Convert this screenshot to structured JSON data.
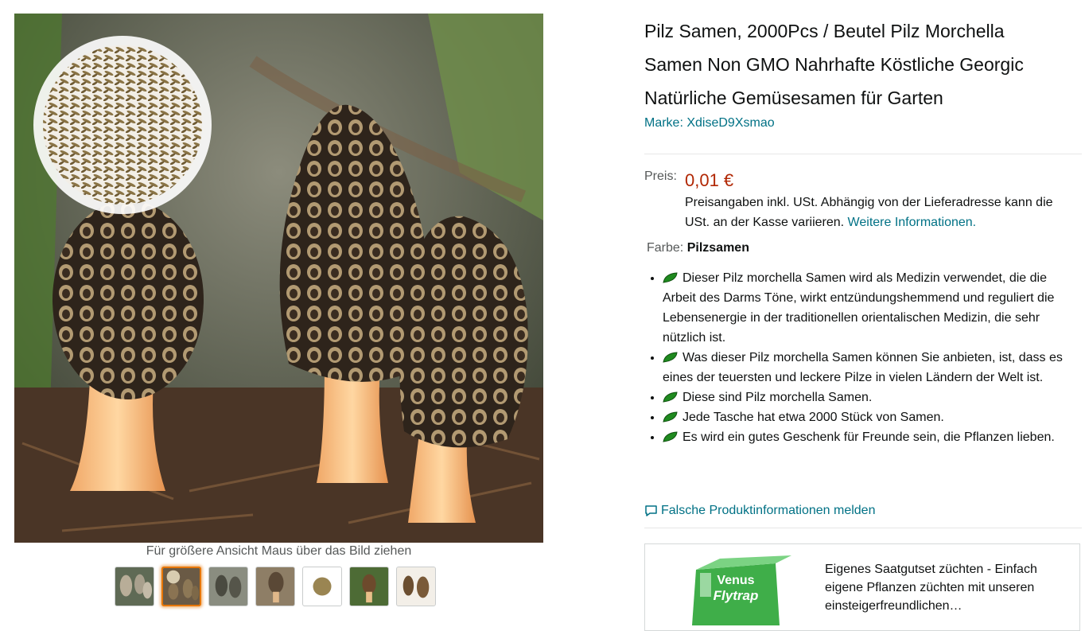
{
  "gallery": {
    "hover_hint": "Für größere Ansicht Maus über das Bild ziehen",
    "thumbnails": [
      "morel-cluster",
      "morel-with-seeds",
      "morels-grey",
      "morel-ground",
      "seeds-closeup",
      "morel-single",
      "morels-white-bg"
    ],
    "active_thumbnail_index": 1
  },
  "product": {
    "title": "Pilz Samen, 2000Pcs / Beutel Pilz Morchella Samen Non GMO Nahrhafte Köstliche Georgic Natürliche Gemüsesamen für Garten",
    "brand_link": "Marke: XdiseD9Xsmao"
  },
  "price": {
    "label": "Preis:",
    "value": "0,01 €",
    "note": "Preisangaben inkl. USt. Abhängig von der Lieferadresse kann die USt. an der Kasse variieren.",
    "more_info_link": "Weitere Informationen."
  },
  "variant": {
    "label": "Farbe:",
    "value": "Pilzsamen"
  },
  "bullets": [
    "Dieser Pilz morchella Samen wird als Medizin verwendet, die die Arbeit des Darms Töne, wirkt entzündungshemmend und reguliert die Lebensenergie in der traditionellen orientalischen Medizin, die sehr nützlich ist.",
    "Was dieser Pilz morchella Samen können Sie anbieten, ist, dass es eines der teuersten und leckere Pilze in vielen Ländern der Welt ist.",
    "Diese sind Pilz morchella Samen.",
    "Jede Tasche hat etwa 2000 Stück von Samen.",
    "Es wird ein gutes Geschenk für Freunde sein, die Pflanzen lieben."
  ],
  "report_link": "Falsche Produktinformationen melden",
  "ad": {
    "box_title_line1": "Venus",
    "box_title_line2": "Flytrap",
    "text": "Eigenes Saatgutset züchten - Einfach eigene Pflanzen züchten mit unseren einsteigerfreundlichen…"
  },
  "colors": {
    "link": "#007185",
    "price": "#b12704",
    "active_thumb_border": "#e77600",
    "leaf_icon": "#1f8a1f"
  }
}
